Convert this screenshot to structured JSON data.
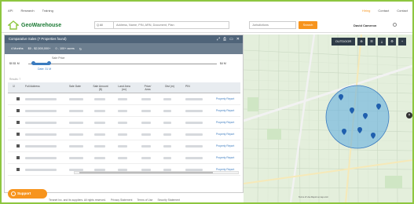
{
  "topnav": {
    "left_links": [
      "API",
      "Research",
      "Training"
    ],
    "right_links": [
      "Hiring",
      "Contact",
      "Contact"
    ]
  },
  "header": {
    "logo_text": "GeoWarehouse",
    "search_type": "Q All",
    "search_placeholder": "Address, Name, PIN, ARN, Document, Plan",
    "location_placeholder": "Jurisdictions",
    "search_button": "Search",
    "account_name": "David Cameron"
  },
  "panel": {
    "title": "Comparative Sales (7 Properties found)",
    "filters": [
      "4 Months",
      "$0 - $2,500,000+",
      "0 - 100+ acres"
    ],
    "slider": {
      "label": "Sale Price",
      "min_label": "$0 $1 M",
      "max_label": "$4 M",
      "mid_label": "Date: 31 M",
      "level_low": 0.03,
      "level_high": 0.12
    },
    "results_count": "Results: 7",
    "columns": [
      "Full Address",
      "Sale Date",
      "Sale Amount ($)",
      "Land Area (m²)",
      "Price/ Area",
      "Dist (m)",
      "PIN",
      ""
    ],
    "rows": [
      {
        "link": "Property Report"
      },
      {
        "link": "Property Report"
      },
      {
        "link": "Property Report"
      },
      {
        "link": "Property Report"
      },
      {
        "link": "Property Report"
      },
      {
        "link": "Property Report"
      },
      {
        "link": "Property Report"
      }
    ]
  },
  "support_label": "Support",
  "footer": {
    "links": [
      "Teranet Inc. and its suppliers. All rights reserved.",
      "Privacy Statement",
      "Terms of Use",
      "Security Statement"
    ]
  },
  "map": {
    "tools": [
      "OUTDOOR",
      "⊕",
      "☰",
      "⤓",
      "⚙",
      "+"
    ],
    "close": "×",
    "attribution": "Terms of Use  Report a map error"
  },
  "colors": {
    "brand_green": "#8dc63f",
    "orange": "#f7941d",
    "panel_header": "#4f6479",
    "link_blue": "#3b7bbf"
  }
}
